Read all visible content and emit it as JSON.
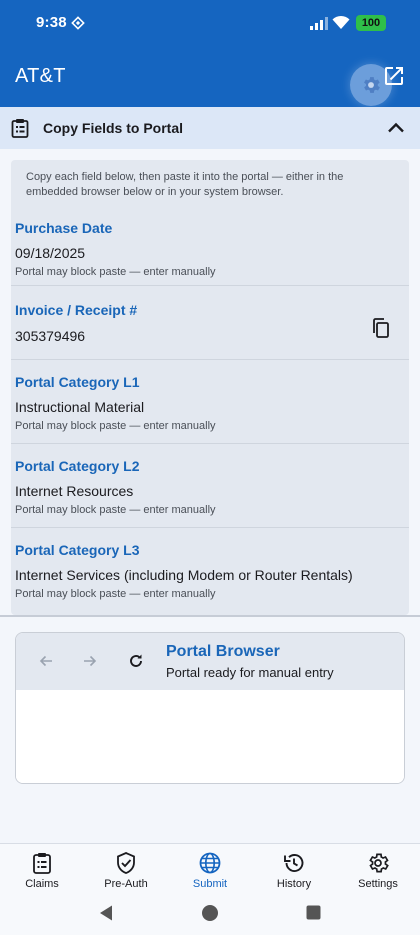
{
  "status_bar": {
    "time": "9:38",
    "battery": "100"
  },
  "app_bar": {
    "title": "AT&T"
  },
  "section": {
    "title": "Copy Fields to Portal"
  },
  "instructions": "Copy each field below, then paste it into the portal — either in the embedded browser below or in your system browser.",
  "fields": [
    {
      "label": "Purchase Date",
      "value": "09/18/2025",
      "note": "Portal may block paste — enter manually"
    },
    {
      "label": "Invoice / Receipt #",
      "value": "305379496",
      "note": ""
    },
    {
      "label": "Portal Category L1",
      "value": "Instructional Material",
      "note": "Portal may block paste — enter manually"
    },
    {
      "label": "Portal Category L2",
      "value": "Internet Resources",
      "note": "Portal may block paste — enter manually"
    },
    {
      "label": "Portal Category L3",
      "value": "Internet Services (including Modem or Router Rentals)",
      "note": "Portal may block paste — enter manually"
    }
  ],
  "browser": {
    "title": "Portal Browser",
    "status": "Portal ready for manual entry"
  },
  "bottom_nav": [
    {
      "label": "Claims",
      "icon": "clipboard-icon",
      "active": false
    },
    {
      "label": "Pre-Auth",
      "icon": "shield-check-icon",
      "active": false
    },
    {
      "label": "Submit",
      "icon": "globe-icon",
      "active": true
    },
    {
      "label": "History",
      "icon": "history-icon",
      "active": false
    },
    {
      "label": "Settings",
      "icon": "gear-icon",
      "active": false
    }
  ],
  "colors": {
    "primary": "#1565c0",
    "label_blue": "#1a66b8",
    "section_bg": "#dce7f7",
    "card_bg": "#e3e8f0"
  }
}
